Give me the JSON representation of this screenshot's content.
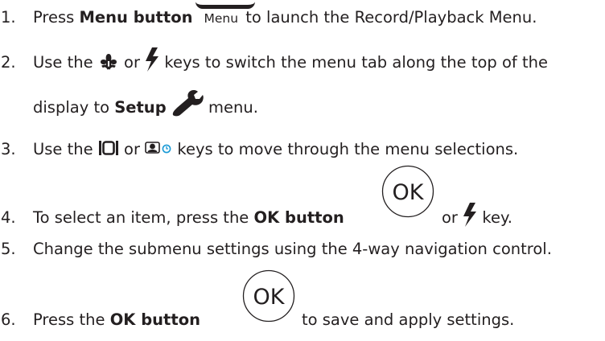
{
  "steps": [
    {
      "num": "1.",
      "before": "Press ",
      "bold": "Menu button",
      "key_label": "Menu",
      "after": " to launch the Record/Playback Menu."
    },
    {
      "num": "2.",
      "before": "Use the ",
      "mid": " or ",
      "after": " keys to switch the menu tab along the top of the",
      "line2_before": "display to ",
      "line2_bold": "Setup",
      "line2_after": " menu."
    },
    {
      "num": "3.",
      "before": "Use the ",
      "mid": " or ",
      "after": " keys to move through the menu selections."
    },
    {
      "num": "4.",
      "before": "To select an item, press the ",
      "bold": "OK button",
      "ok_label": "OK",
      "mid": "or ",
      "after": " key."
    },
    {
      "num": "5.",
      "text": "Change the submenu settings using the 4-way navigation control."
    },
    {
      "num": "6.",
      "before": "Press the ",
      "bold": "OK button",
      "ok_label": "OK",
      "after": " to save and apply settings."
    }
  ],
  "icons": {
    "macro": "macro-flower-icon",
    "flash": "flash-icon",
    "setup": "wrench-icon",
    "display": "display-icon",
    "selftimer": "face-timer-icon"
  },
  "colors": {
    "text": "#231f20",
    "timer_accent": "#1a9ad6"
  }
}
